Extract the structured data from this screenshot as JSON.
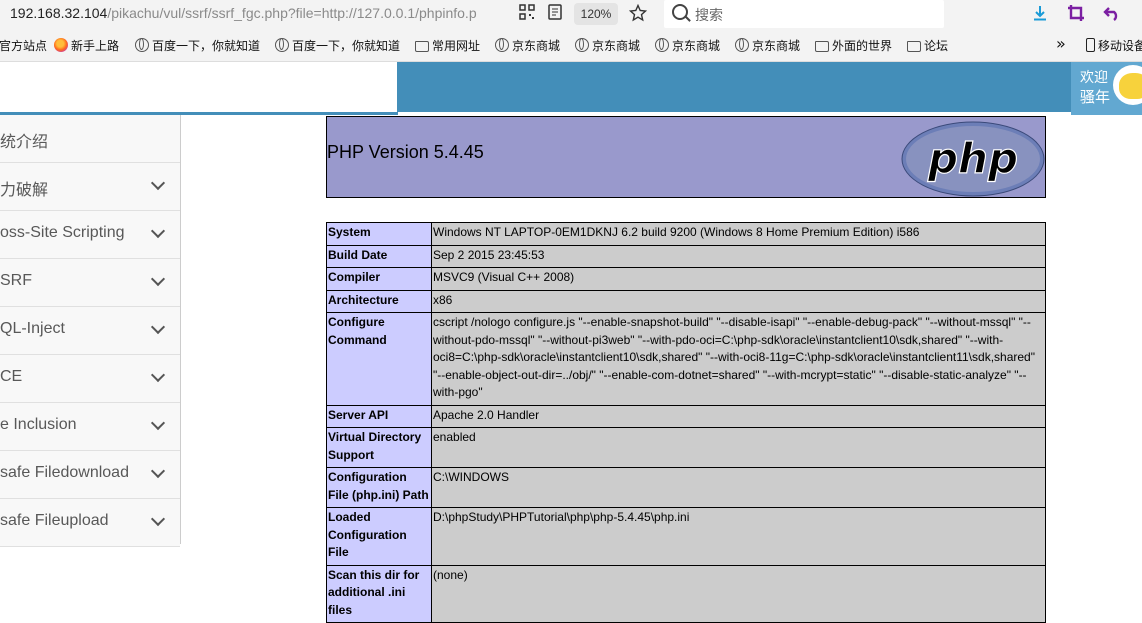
{
  "browser": {
    "url_main": "192.168.32.104",
    "url_rest": "/pikachu/vul/ssrf/ssrf_fgc.php?file=http://127.0.0.1/phpinfo.p",
    "zoom": "120%",
    "search_placeholder": "搜索",
    "bookmarks": [
      {
        "label": "官方站点",
        "icon": "none"
      },
      {
        "label": "新手上路",
        "icon": "firefox-icon"
      },
      {
        "label": "百度一下，你就知道",
        "icon": "globe-icon"
      },
      {
        "label": "百度一下，你就知道",
        "icon": "globe-icon"
      },
      {
        "label": "常用网址",
        "icon": "folder-icon"
      },
      {
        "label": "京东商城",
        "icon": "globe-icon"
      },
      {
        "label": "京东商城",
        "icon": "globe-icon"
      },
      {
        "label": "京东商城",
        "icon": "globe-icon"
      },
      {
        "label": "京东商城",
        "icon": "globe-icon"
      },
      {
        "label": "外面的世界",
        "icon": "folder-icon"
      },
      {
        "label": "论坛",
        "icon": "folder-icon"
      }
    ],
    "overflow_glyph": "»",
    "mobile_bookmarks": "移动设备"
  },
  "header": {
    "welcome": "欢迎",
    "user": "骚年"
  },
  "sidebar": {
    "items": [
      {
        "label": "统介绍",
        "has_arrow": false
      },
      {
        "label": "力破解",
        "has_arrow": true
      },
      {
        "label": "oss-Site Scripting",
        "has_arrow": true
      },
      {
        "label": "SRF",
        "has_arrow": true
      },
      {
        "label": "QL-Inject",
        "has_arrow": true
      },
      {
        "label": "CE",
        "has_arrow": true
      },
      {
        "label": "e Inclusion",
        "has_arrow": true
      },
      {
        "label": "safe Filedownload",
        "has_arrow": true
      },
      {
        "label": "safe Fileupload",
        "has_arrow": true
      }
    ]
  },
  "phpinfo": {
    "title": "PHP Version 5.4.45",
    "logo_text": "php",
    "rows": [
      {
        "key": "System",
        "value": "Windows NT LAPTOP-0EM1DKNJ 6.2 build 9200 (Windows 8 Home Premium Edition) i586"
      },
      {
        "key": "Build Date",
        "value": "Sep 2 2015 23:45:53"
      },
      {
        "key": "Compiler",
        "value": "MSVC9 (Visual C++ 2008)"
      },
      {
        "key": "Architecture",
        "value": "x86"
      },
      {
        "key": "Configure Command",
        "value": "cscript /nologo configure.js \"--enable-snapshot-build\" \"--disable-isapi\" \"--enable-debug-pack\" \"--without-mssql\" \"--without-pdo-mssql\" \"--without-pi3web\" \"--with-pdo-oci=C:\\php-sdk\\oracle\\instantclient10\\sdk,shared\" \"--with-oci8=C:\\php-sdk\\oracle\\instantclient10\\sdk,shared\" \"--with-oci8-11g=C:\\php-sdk\\oracle\\instantclient11\\sdk,shared\" \"--enable-object-out-dir=../obj/\" \"--enable-com-dotnet=shared\" \"--with-mcrypt=static\" \"--disable-static-analyze\" \"--with-pgo\""
      },
      {
        "key": "Server API",
        "value": "Apache 2.0 Handler"
      },
      {
        "key": "Virtual Directory Support",
        "value": "enabled"
      },
      {
        "key": "Configuration File (php.ini) Path",
        "value": "C:\\WINDOWS"
      },
      {
        "key": "Loaded Configuration File",
        "value": "D:\\phpStudy\\PHPTutorial\\php\\php-5.4.45\\php.ini"
      },
      {
        "key": "Scan this dir for additional .ini files",
        "value": "(none)"
      }
    ]
  }
}
